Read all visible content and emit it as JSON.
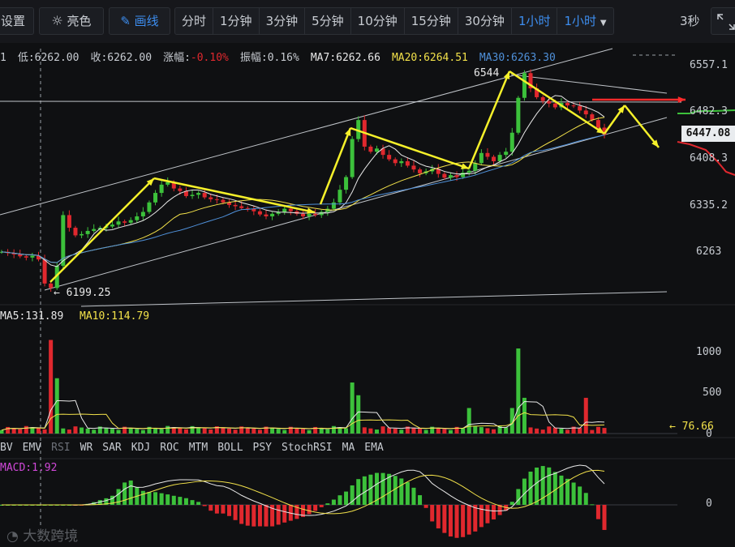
{
  "toolbar": {
    "settings": "设置",
    "brightness": "亮色",
    "draw": "画线",
    "intervals": [
      "分时",
      "1分钟",
      "3分钟",
      "5分钟",
      "10分钟",
      "15分钟",
      "30分钟",
      "1小时",
      "1小时"
    ],
    "active_interval": "1小时",
    "refresh": "3秒"
  },
  "info": {
    "cut": "1",
    "low": "低:6262.00",
    "close": "收:6262.00",
    "change_label": "涨幅:",
    "change_value": "-0.10%",
    "amplitude": "振幅:0.16%",
    "ma7": "MA7:6262.66",
    "ma20": "MA20:6264.51",
    "ma30": "MA30:6263.30"
  },
  "price_axis": [
    "6557.1",
    "6482.3",
    "6408.3",
    "6335.2",
    "6263"
  ],
  "current_price": "6447.08",
  "annotations": {
    "high": "6544",
    "low": "← 6199.25",
    "volume_last": "← 76.66"
  },
  "volume_header": {
    "ma5": "MA5:131.89",
    "ma10": "MA10:114.79"
  },
  "volume_axis": [
    "1000",
    "500",
    "0"
  ],
  "indicator_tabs": [
    "BV",
    "EMV",
    "RSI",
    "WR",
    "SAR",
    "KDJ",
    "ROC",
    "MTM",
    "BOLL",
    "PSY",
    "StochRSI",
    "MA",
    "EMA"
  ],
  "macd": {
    "label": "MACD:1.92",
    "axis": "0"
  },
  "watermark": "大数跨境",
  "colors": {
    "up": "#3cc13b",
    "down": "#e0282e",
    "ma_white": "#e8e8e8",
    "ma_yellow": "#f2e14a",
    "ma_blue": "#4f90d9",
    "arrow_yellow": "#f5f02a",
    "arrow_red": "#ff2a2a",
    "macd_label": "#d048d8"
  },
  "chart_data": {
    "type": "candlestick",
    "timeframe": "1小时",
    "y_axis_ticks": [
      6557.1,
      6482.3,
      6408.3,
      6335.2,
      6263
    ],
    "high": 6544,
    "low": 6199.25,
    "last_price": 6447.08,
    "close_series": [
      6262,
      6260,
      6258,
      6255,
      6253,
      6256,
      6250,
      6212,
      6205,
      6240,
      6320,
      6300,
      6288,
      6290,
      6295,
      6298,
      6300,
      6302,
      6305,
      6310,
      6308,
      6312,
      6318,
      6325,
      6340,
      6355,
      6368,
      6372,
      6362,
      6358,
      6350,
      6352,
      6355,
      6348,
      6345,
      6344,
      6340,
      6336,
      6334,
      6331,
      6330,
      6326,
      6321,
      6318,
      6322,
      6325,
      6330,
      6326,
      6322,
      6318,
      6322,
      6320,
      6325,
      6330,
      6340,
      6360,
      6380,
      6440,
      6470,
      6428,
      6420,
      6425,
      6415,
      6408,
      6402,
      6405,
      6398,
      6392,
      6386,
      6389,
      6393,
      6385,
      6379,
      6383,
      6380,
      6387,
      6390,
      6402,
      6418,
      6412,
      6405,
      6415,
      6420,
      6450,
      6505,
      6544,
      6520,
      6506,
      6500,
      6496,
      6490,
      6497,
      6493,
      6492,
      6485,
      6479,
      6470,
      6458,
      6447
    ],
    "volume": {
      "ma5": 131.89,
      "ma10": 114.79,
      "last": 76.66,
      "ticks": [
        1000,
        500,
        0
      ]
    },
    "macd": {
      "value": 1.92
    }
  }
}
